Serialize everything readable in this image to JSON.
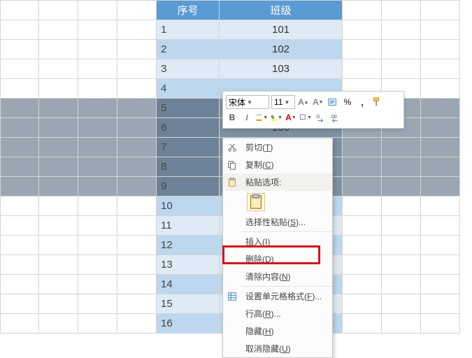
{
  "header": {
    "idx": "序号",
    "class": "班级"
  },
  "rows": [
    {
      "n": "1",
      "c": "101"
    },
    {
      "n": "2",
      "c": "102"
    },
    {
      "n": "3",
      "c": "103"
    },
    {
      "n": "4",
      "c": ""
    },
    {
      "n": "5",
      "c": ""
    },
    {
      "n": "6",
      "c": "106"
    },
    {
      "n": "7",
      "c": ""
    },
    {
      "n": "8",
      "c": ""
    },
    {
      "n": "9",
      "c": ""
    },
    {
      "n": "10",
      "c": ""
    },
    {
      "n": "11",
      "c": ""
    },
    {
      "n": "12",
      "c": ""
    },
    {
      "n": "13",
      "c": ""
    },
    {
      "n": "14",
      "c": ""
    },
    {
      "n": "15",
      "c": ""
    },
    {
      "n": "16",
      "c": ""
    }
  ],
  "mini": {
    "font": "宋体",
    "size": "11",
    "bold": "B",
    "italic": "I"
  },
  "ctx": {
    "cut": "剪切(T)",
    "copy": "复制(C)",
    "paste_opts": "粘贴选项:",
    "paste_special": "选择性粘贴(S)...",
    "insert": "插入(I)",
    "delete": "删除(D)",
    "clear": "清除内容(N)",
    "format": "设置单元格格式(F)...",
    "rowh": "行高(R)...",
    "hide": "隐藏(H)",
    "unhide": "取消隐藏(U)"
  },
  "chart_data": {
    "type": "table",
    "title": "",
    "columns": [
      "序号",
      "班级"
    ],
    "rows": [
      [
        "1",
        "101"
      ],
      [
        "2",
        "102"
      ],
      [
        "3",
        "103"
      ],
      [
        "4",
        ""
      ],
      [
        "5",
        ""
      ],
      [
        "6",
        "106"
      ],
      [
        "7",
        ""
      ],
      [
        "8",
        ""
      ],
      [
        "9",
        ""
      ],
      [
        "10",
        ""
      ],
      [
        "11",
        ""
      ],
      [
        "12",
        ""
      ],
      [
        "13",
        ""
      ],
      [
        "14",
        ""
      ],
      [
        "15",
        ""
      ],
      [
        "16",
        ""
      ]
    ]
  }
}
